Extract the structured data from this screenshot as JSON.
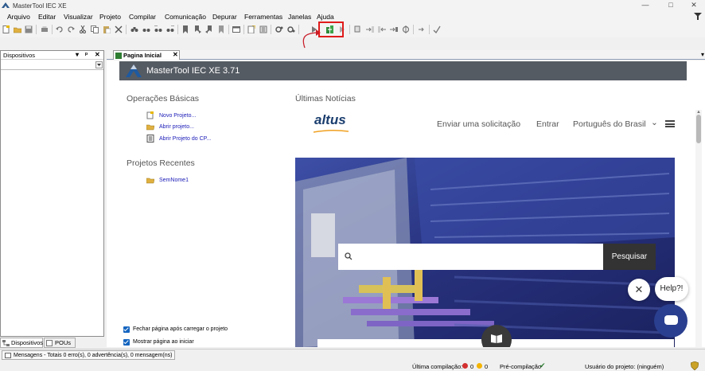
{
  "window": {
    "title": "MasterTool IEC XE",
    "minimize": "—",
    "maximize": "□",
    "close": "✕"
  },
  "menu": [
    "Arquivo",
    "Editar",
    "Visualizar",
    "Projeto",
    "Compilar",
    "Comunicação",
    "Depurar",
    "Ferramentas",
    "Janelas",
    "Ajuda"
  ],
  "devices_panel": {
    "title": "Dispositivos",
    "dropdown_glyph": "▾",
    "pin_glyph": "ᵖ",
    "close_glyph": "✕",
    "tabs": [
      "Dispositivos",
      "POUs"
    ]
  },
  "document_tab": {
    "label": "Pagina Inicial",
    "close_glyph": "✕",
    "menu_glyph": "▾"
  },
  "start_page": {
    "banner_title": "MasterTool IEC XE 3.71",
    "basic_ops_title": "Operações Básicas",
    "basic_ops": [
      {
        "label": "Novo Projeto...",
        "icon": "new-project-icon"
      },
      {
        "label": "Abrir projeto...",
        "icon": "open-folder-icon"
      },
      {
        "label": "Abrir Projeto do CP...",
        "icon": "plc-icon"
      }
    ],
    "recent_title": "Projetos Recentes",
    "recent": [
      {
        "label": "SemNome1",
        "icon": "open-folder-icon"
      }
    ],
    "news_title": "Últimas Notícias",
    "options": [
      {
        "label": "Fechar página após carregar o projeto",
        "checked": true
      },
      {
        "label": "Mostrar página ao iniciar",
        "checked": true
      }
    ]
  },
  "news": {
    "logo": "altus",
    "nav": [
      "Enviar uma solicitação",
      "Entrar",
      "Português do Brasil"
    ],
    "lang_chevron": "⌄",
    "search_placeholder": "",
    "search_button": "Pesquisar",
    "chat_help": "Help?!",
    "chat_close": "✕"
  },
  "messages_bar": {
    "label": "Mensagens - Totais 0 erro(s), 0 advertência(s), 0 mensagem(ns)"
  },
  "status_bar": {
    "last_build_label": "Última compilação:",
    "errors": "0",
    "warnings": "0",
    "precompile_label": "Pré-compilação",
    "precompile_ok": "✔",
    "user_label": "Usuário do projeto: (ninguém)"
  },
  "colors": {
    "highlight": "#e01b1b",
    "banner": "#555b63",
    "link": "#1a1ab8",
    "hero": "#2a3a8c",
    "chat_launcher": "#2a3f8f"
  }
}
